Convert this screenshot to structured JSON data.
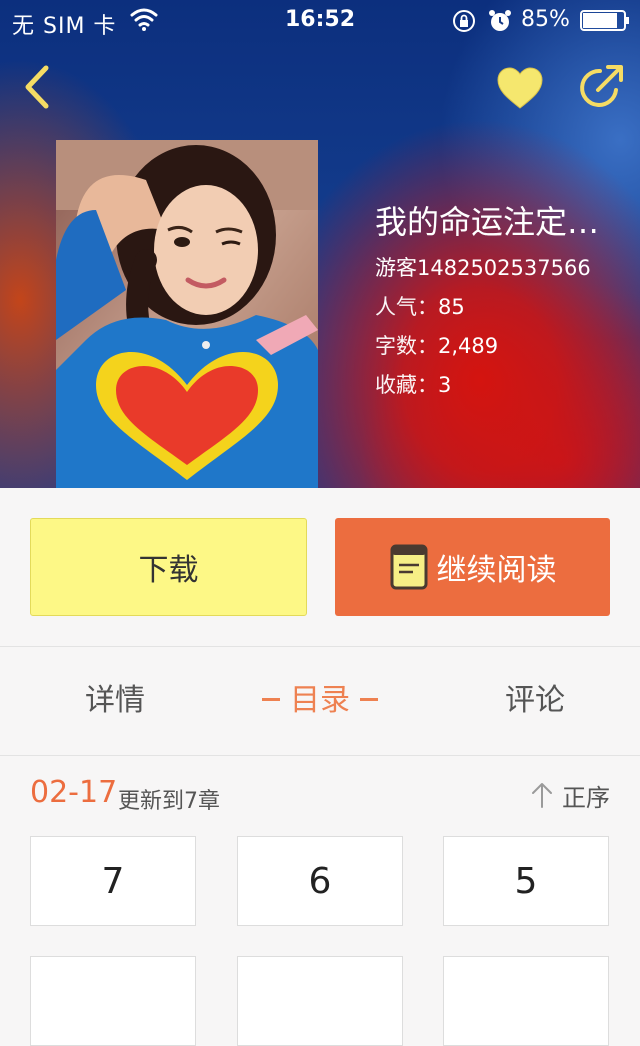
{
  "status_bar": {
    "carrier": "无 SIM 卡",
    "time": "16:52",
    "battery": "85%",
    "battery_level": 0.85
  },
  "nav": {
    "back_icon": "chevron-left-icon",
    "favorite_icon": "heart-icon",
    "share_icon": "share-icon",
    "accent_color": "#f5dc64"
  },
  "book": {
    "title": "我的命运注定…",
    "author": "游客1482502537566",
    "popularity_label": "人气：",
    "popularity": "85",
    "word_count_label": "字数：",
    "word_count": "2,489",
    "favorites_label": "收藏：",
    "favorites": "3"
  },
  "actions": {
    "download": "下载",
    "continue_reading": "继续阅读",
    "download_color": "#fdf886",
    "read_color": "#ec6d3f"
  },
  "tabs": {
    "details": "详情",
    "toc": "目录",
    "comments": "评论",
    "active": "toc"
  },
  "toc": {
    "date": "02-17",
    "update_text": "更新到7章",
    "sort_label": "正序",
    "chapters": [
      "7",
      "6",
      "5"
    ]
  }
}
